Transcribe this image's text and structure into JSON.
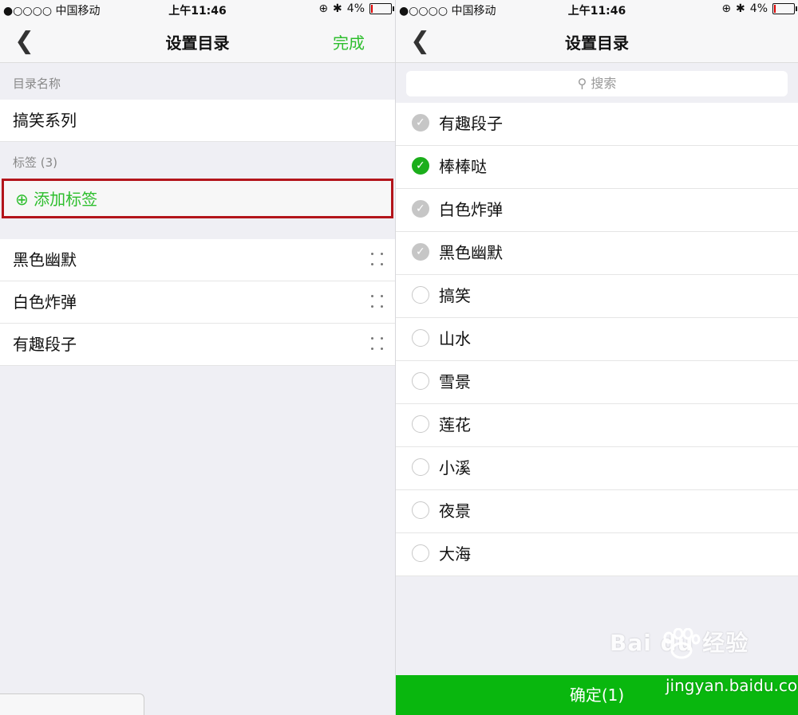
{
  "status_bar": {
    "carrier": "●○○○○ 中国移动",
    "time": "上午11:46",
    "battery": "4%"
  },
  "left": {
    "title": "设置目录",
    "done_label": "完成",
    "name_section": "目录名称",
    "name_value": "搞笑系列",
    "tags_section": "标签 (3)",
    "add_tag": "⊕ 添加标签",
    "tags": [
      "黑色幽默",
      "白色炸弹",
      "有趣段子"
    ]
  },
  "right": {
    "title": "设置目录",
    "search_placeholder": "搜索",
    "items": [
      {
        "label": "有趣段子",
        "state": "gray"
      },
      {
        "label": "棒棒哒",
        "state": "green"
      },
      {
        "label": "白色炸弹",
        "state": "gray"
      },
      {
        "label": "黑色幽默",
        "state": "gray"
      },
      {
        "label": "搞笑",
        "state": "empty"
      },
      {
        "label": "山水",
        "state": "empty"
      },
      {
        "label": "雪景",
        "state": "empty"
      },
      {
        "label": "莲花",
        "state": "empty"
      },
      {
        "label": "小溪",
        "state": "empty"
      },
      {
        "label": "夜景",
        "state": "empty"
      },
      {
        "label": "大海",
        "state": "empty"
      }
    ],
    "confirm_label": "确定(1)"
  },
  "watermark": {
    "brand": "Bai  du 经验",
    "url": "jingyan.baidu.com"
  },
  "colors": {
    "accent": "#2dbe2d",
    "confirm_bg": "#09b70e",
    "highlight": "#b3151b"
  }
}
